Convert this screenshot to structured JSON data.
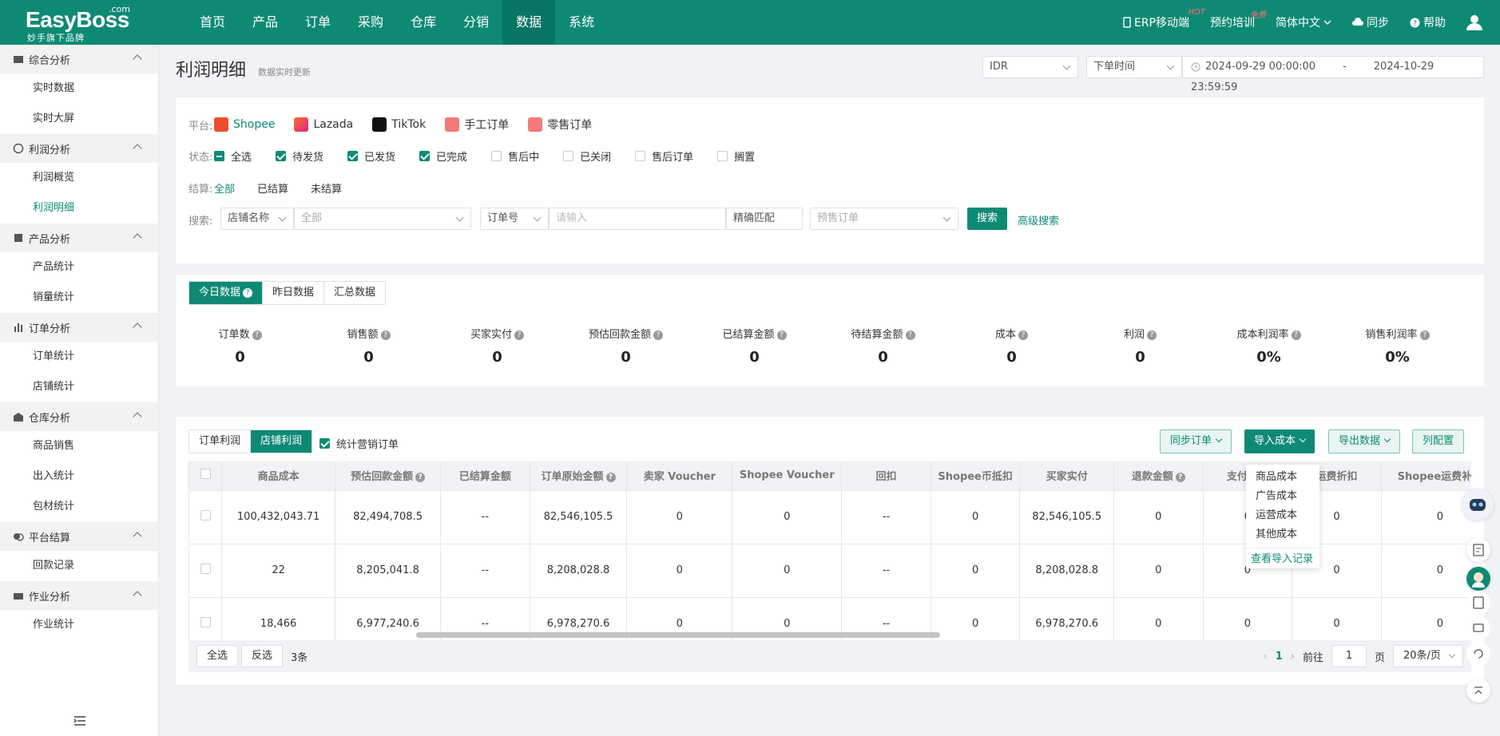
{
  "brand": {
    "name": "EasyBoss",
    "com": ".com",
    "sub": "妙手旗下品牌"
  },
  "nav": [
    "首页",
    "产品",
    "订单",
    "采购",
    "仓库",
    "分销",
    "数据",
    "系统"
  ],
  "topright": {
    "erp": "ERP移动端",
    "erp_badge": "HOT",
    "train": "预约培训",
    "train_badge": "免费",
    "lang": "简体中文",
    "sync": "同步",
    "help": "帮助"
  },
  "sidebar": [
    {
      "group": "综合分析",
      "items": [
        "实时数据",
        "实时大屏"
      ]
    },
    {
      "group": "利润分析",
      "items": [
        "利润概览",
        "利润明细"
      ]
    },
    {
      "group": "产品分析",
      "items": [
        "产品统计",
        "销量统计"
      ]
    },
    {
      "group": "订单分析",
      "items": [
        "订单统计",
        "店铺统计"
      ]
    },
    {
      "group": "仓库分析",
      "items": [
        "商品销售",
        "出入统计",
        "包材统计"
      ]
    },
    {
      "group": "平台结算",
      "items": [
        "回款记录"
      ]
    },
    {
      "group": "作业分析",
      "items": [
        "作业统计"
      ]
    }
  ],
  "page": {
    "title": "利润明细",
    "subtitle": "数据实时更新",
    "currency": "IDR",
    "time_type": "下单时间",
    "date_start": "2024-09-29 00:00:00",
    "date_sep": "-",
    "date_end": "2024-10-29 23:59:59"
  },
  "filters": {
    "platform_label": "平台:",
    "platforms": [
      "Shopee",
      "Lazada",
      "TikTok",
      "手工订单",
      "零售订单"
    ],
    "status_label": "状态:",
    "statuses": [
      {
        "t": "全选",
        "s": "ind"
      },
      {
        "t": "待发货",
        "s": "on"
      },
      {
        "t": "已发货",
        "s": "on"
      },
      {
        "t": "已完成",
        "s": "on"
      },
      {
        "t": "售后中",
        "s": ""
      },
      {
        "t": "已关闭",
        "s": ""
      },
      {
        "t": "售后订单",
        "s": ""
      },
      {
        "t": "搁置",
        "s": ""
      }
    ],
    "settle_label": "结算:",
    "settles": [
      "全部",
      "已结算",
      "未结算"
    ],
    "search_label": "搜索:",
    "shop_field": "店铺名称",
    "shop_value": "全部",
    "order_field": "订单号",
    "order_placeholder": "请输入",
    "match": "精确匹配",
    "presale_placeholder": "预售订单",
    "search_btn": "搜索",
    "advanced": "高级搜索"
  },
  "data_tabs": [
    "今日数据",
    "昨日数据",
    "汇总数据"
  ],
  "stats": [
    {
      "label": "订单数",
      "value": "0"
    },
    {
      "label": "销售额",
      "value": "0"
    },
    {
      "label": "买家实付",
      "value": "0"
    },
    {
      "label": "预估回款金额",
      "value": "0"
    },
    {
      "label": "已结算金额",
      "value": "0"
    },
    {
      "label": "待结算金额",
      "value": "0"
    },
    {
      "label": "成本",
      "value": "0"
    },
    {
      "label": "利润",
      "value": "0"
    },
    {
      "label": "成本利润率",
      "value": "0%"
    },
    {
      "label": "销售利润率",
      "value": "0%"
    }
  ],
  "table_tabs": [
    "订单利润",
    "店铺利润"
  ],
  "marketing_label": "统计营销订单",
  "actions": {
    "sync": "同步订单",
    "import": "导入成本",
    "export": "导出数据",
    "columns": "列配置"
  },
  "import_menu": [
    "商品成本",
    "广告成本",
    "运营成本",
    "其他成本"
  ],
  "import_link": "查看导入记录",
  "columns": [
    "商品成本",
    "预估回款金额",
    "已结算金额",
    "订单原始金额",
    "卖家 Voucher",
    "Shopee Voucher",
    "回扣",
    "Shopee币抵扣",
    "买家实付",
    "退款金额",
    "支付优惠",
    "运费折扣",
    "Shopee运费补贴"
  ],
  "rows": [
    [
      "100,432,043.71",
      "82,494,708.5",
      "--",
      "82,546,105.5",
      "0",
      "0",
      "--",
      "0",
      "82,546,105.5",
      "0",
      "0",
      "0",
      "0"
    ],
    [
      "22",
      "8,205,041.8",
      "--",
      "8,208,028.8",
      "0",
      "0",
      "--",
      "0",
      "8,208,028.8",
      "0",
      "0",
      "0",
      "0"
    ],
    [
      "18,466",
      "6,977,240.6",
      "--",
      "6,978,270.6",
      "0",
      "0",
      "--",
      "0",
      "6,978,270.6",
      "0",
      "0",
      "0",
      "0"
    ]
  ],
  "footer": {
    "select_all": "全选",
    "invert": "反选",
    "count": "3条",
    "page": "1",
    "goto": "前往",
    "page_input": "1",
    "page_unit": "页",
    "page_size": "20条/页"
  }
}
